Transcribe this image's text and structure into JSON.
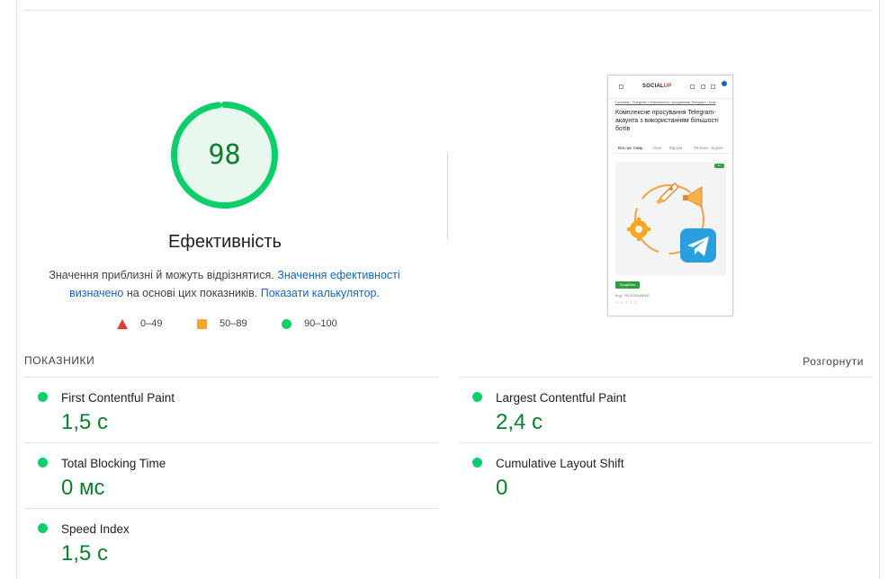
{
  "score": {
    "value": "98",
    "fraction": 0.98,
    "title": "Ефективність",
    "color": "#0cce6b",
    "text_color": "#0c7f2c"
  },
  "description": {
    "part1": "Значення приблизні й можуть відрізнятися. ",
    "link1": "Значення ефективності визначено",
    "part2": " на основі цих показників. ",
    "link2": "Показати калькулятор",
    "part3": "."
  },
  "legend": [
    {
      "icon": "red-triangle-icon",
      "label": "0–49",
      "color": "#e53935"
    },
    {
      "icon": "orange-square-icon",
      "label": "50–89",
      "color": "#f9a825"
    },
    {
      "icon": "green-circle-icon",
      "label": "90–100",
      "color": "#0cce6b"
    }
  ],
  "screenshot": {
    "logo_main": "SOCIAL",
    "logo_accent": "UP",
    "breadcrumb": "Головна / Telegram / Комплексне просування Telegram / Ком",
    "title": "Комплексне просування Telegram-акаунта з використанням більшості ботів",
    "tabs": [
      "Все про товар",
      "Опис",
      "Відгуки",
      "Питання - відпов"
    ],
    "tag": "Хіт",
    "buy_button": "Придбати",
    "code": "Код: TELEGRAM000"
  },
  "metrics": {
    "header": "ПОКАЗНИКИ",
    "expand_label": "Розгорнути",
    "items": [
      {
        "title": "First Contentful Paint",
        "value": "1,5 с",
        "status": "good"
      },
      {
        "title": "Largest Contentful Paint",
        "value": "2,4 с",
        "status": "good"
      },
      {
        "title": "Total Blocking Time",
        "value": "0 мс",
        "status": "good"
      },
      {
        "title": "Cumulative Layout Shift",
        "value": "0",
        "status": "good"
      },
      {
        "title": "Speed Index",
        "value": "1,5 с",
        "status": "good"
      }
    ]
  }
}
